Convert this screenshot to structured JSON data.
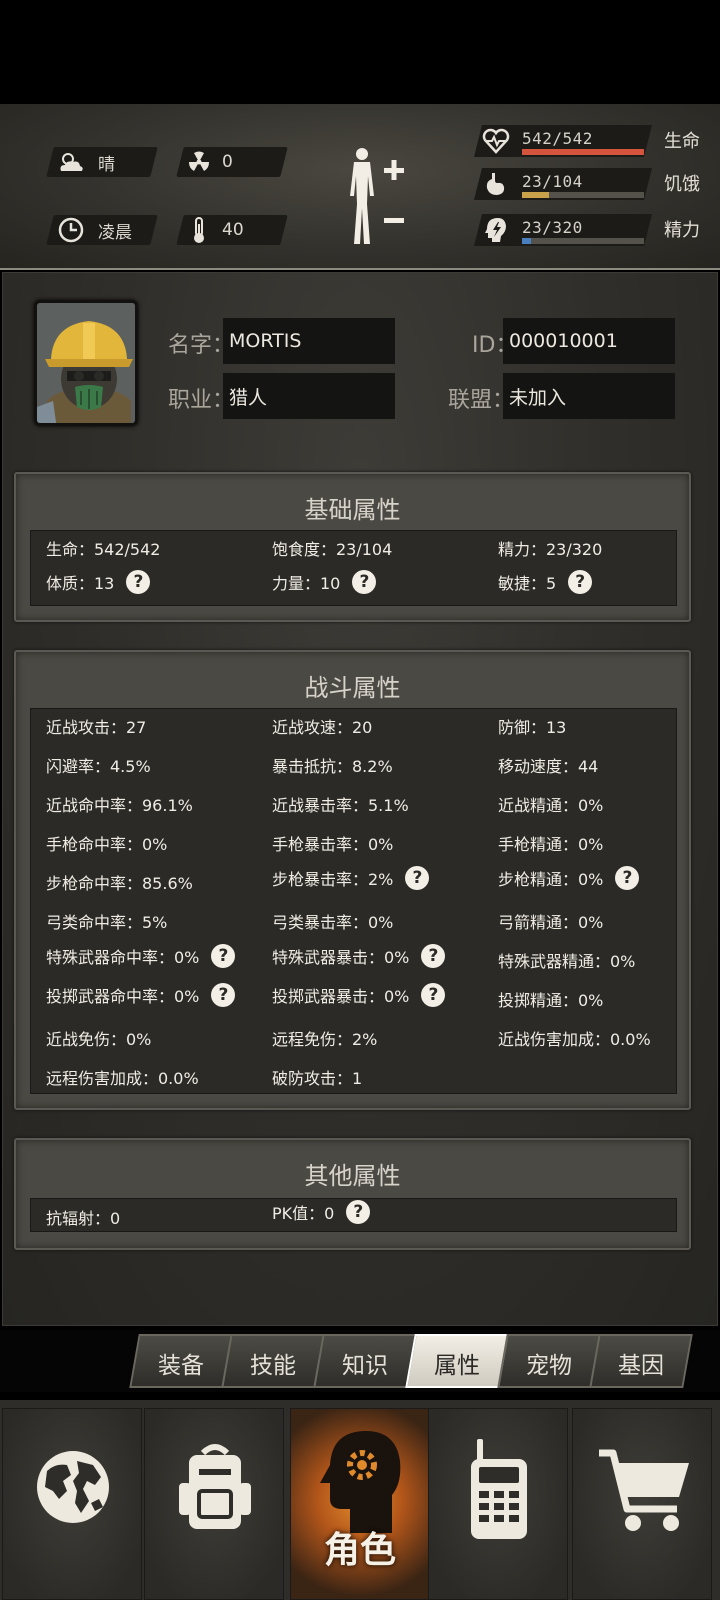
{
  "status": {
    "weather": "晴",
    "radiation": "0",
    "time_of_day": "凌晨",
    "temperature": "40"
  },
  "vitals": [
    {
      "label": "生命",
      "value": "542/542",
      "fill": 1.0,
      "color": "#d4543e",
      "icon": "heart-icon"
    },
    {
      "label": "饥饿",
      "value": "23/104",
      "fill": 0.22,
      "color": "#c9a14a",
      "icon": "stomach-icon"
    },
    {
      "label": "精力",
      "value": "23/320",
      "fill": 0.07,
      "color": "#4a7fbf",
      "icon": "head-lightning-icon"
    }
  ],
  "profile": {
    "name_label": "名字",
    "name_value": "MORTIS",
    "id_label": "ID",
    "id_value": "000010001",
    "job_label": "职业",
    "job_value": "猎人",
    "alliance_label": "联盟",
    "alliance_value": "未加入"
  },
  "basic": {
    "title": "基础属性",
    "rows": [
      [
        "生命：542/542",
        "饱食度：23/104",
        "精力：23/320"
      ],
      [
        "体质：13",
        "力量：10",
        "敏捷：5"
      ]
    ]
  },
  "combat": {
    "title": "战斗属性",
    "rows": [
      [
        "近战攻击：27",
        "近战攻速：20",
        "防御：13"
      ],
      [
        "闪避率：4.5%",
        "暴击抵抗：8.2%",
        "移动速度：44"
      ],
      [
        "近战命中率：96.1%",
        "近战暴击率：5.1%",
        "近战精通：0%"
      ],
      [
        "手枪命中率：0%",
        "手枪暴击率：0%",
        "手枪精通：0%"
      ],
      [
        "步枪命中率：85.6%",
        "步枪暴击率：2%",
        "步枪精通：0%"
      ],
      [
        "弓类命中率：5%",
        "弓类暴击率：0%",
        "弓箭精通：0%"
      ],
      [
        "特殊武器命中率：0%",
        "特殊武器暴击：0%",
        "特殊武器精通：0%"
      ],
      [
        "投掷武器命中率：0%",
        "投掷武器暴击：0%",
        "投掷精通：0%"
      ],
      [
        "近战免伤：0%",
        "远程免伤：2%",
        "近战伤害加成：0.0%"
      ],
      [
        "远程伤害加成：0.0%",
        "破防攻击：1",
        ""
      ]
    ]
  },
  "other": {
    "title": "其他属性",
    "rows": [
      [
        "抗辐射：0",
        "PK值：0",
        ""
      ]
    ]
  },
  "help_glyph": "?",
  "tabs": [
    "装备",
    "技能",
    "知识",
    "属性",
    "宠物",
    "基因"
  ],
  "active_tab": "属性",
  "nav": {
    "character_label": "角色"
  }
}
